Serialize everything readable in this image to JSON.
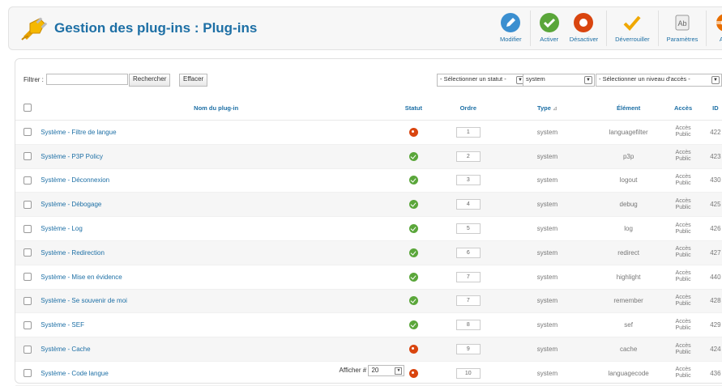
{
  "header": {
    "title": "Gestion des plug-ins : Plug-ins",
    "toolbar": [
      {
        "label": "Modifier",
        "icon": "edit-icon",
        "color": "#3b8fd0"
      },
      {
        "label": "Activer",
        "icon": "publish-icon",
        "color": "#5aa63a"
      },
      {
        "label": "Désactiver",
        "icon": "unpublish-icon",
        "color": "#d9450f"
      },
      {
        "label": "Déverrouiller",
        "icon": "checkin-icon",
        "color": "#f0a800"
      },
      {
        "label": "Paramètres",
        "icon": "options-icon",
        "color": "#999999"
      },
      {
        "label": "Aide",
        "icon": "help-icon",
        "color": "#e86e00"
      }
    ]
  },
  "filter": {
    "label": "Filtrer :",
    "search_value": "",
    "search_button": "Rechercher",
    "clear_button": "Effacer",
    "status_select": "- Sélectionner un statut -",
    "folder_select": "system",
    "access_select": "- Sélectionner un niveau d'accès -"
  },
  "table": {
    "headers": {
      "name": "Nom du plug-in",
      "status": "Statut",
      "order": "Ordre",
      "type": "Type",
      "element": "Élément",
      "access": "Accès",
      "id": "ID"
    },
    "rows": [
      {
        "name": "Système - Filtre de langue",
        "status": "off",
        "order": "1",
        "type": "system",
        "element": "languagefilter",
        "access1": "Accès",
        "access2": "Public",
        "id": "422"
      },
      {
        "name": "Système - P3P Policy",
        "status": "on",
        "order": "2",
        "type": "system",
        "element": "p3p",
        "access1": "Accès",
        "access2": "Public",
        "id": "423"
      },
      {
        "name": "Système - Déconnexion",
        "status": "on",
        "order": "3",
        "type": "system",
        "element": "logout",
        "access1": "Accès",
        "access2": "Public",
        "id": "430"
      },
      {
        "name": "Système - Débogage",
        "status": "on",
        "order": "4",
        "type": "system",
        "element": "debug",
        "access1": "Accès",
        "access2": "Public",
        "id": "425"
      },
      {
        "name": "Système - Log",
        "status": "on",
        "order": "5",
        "type": "system",
        "element": "log",
        "access1": "Accès",
        "access2": "Public",
        "id": "426"
      },
      {
        "name": "Système - Redirection",
        "status": "on",
        "order": "6",
        "type": "system",
        "element": "redirect",
        "access1": "Accès",
        "access2": "Public",
        "id": "427"
      },
      {
        "name": "Système - Mise en évidence",
        "status": "on",
        "order": "7",
        "type": "system",
        "element": "highlight",
        "access1": "Accès",
        "access2": "Public",
        "id": "440"
      },
      {
        "name": "Système - Se souvenir de moi",
        "status": "on",
        "order": "7",
        "type": "system",
        "element": "remember",
        "access1": "Accès",
        "access2": "Public",
        "id": "428"
      },
      {
        "name": "Système - SEF",
        "status": "on",
        "order": "8",
        "type": "system",
        "element": "sef",
        "access1": "Accès",
        "access2": "Public",
        "id": "429"
      },
      {
        "name": "Système - Cache",
        "status": "off",
        "order": "9",
        "type": "system",
        "element": "cache",
        "access1": "Accès",
        "access2": "Public",
        "id": "424"
      },
      {
        "name": "Système - Code langue",
        "status": "off",
        "order": "10",
        "type": "system",
        "element": "languagecode",
        "access1": "Accès",
        "access2": "Public",
        "id": "436"
      }
    ]
  },
  "footer": {
    "display_label": "Afficher #",
    "display_value": "20"
  }
}
